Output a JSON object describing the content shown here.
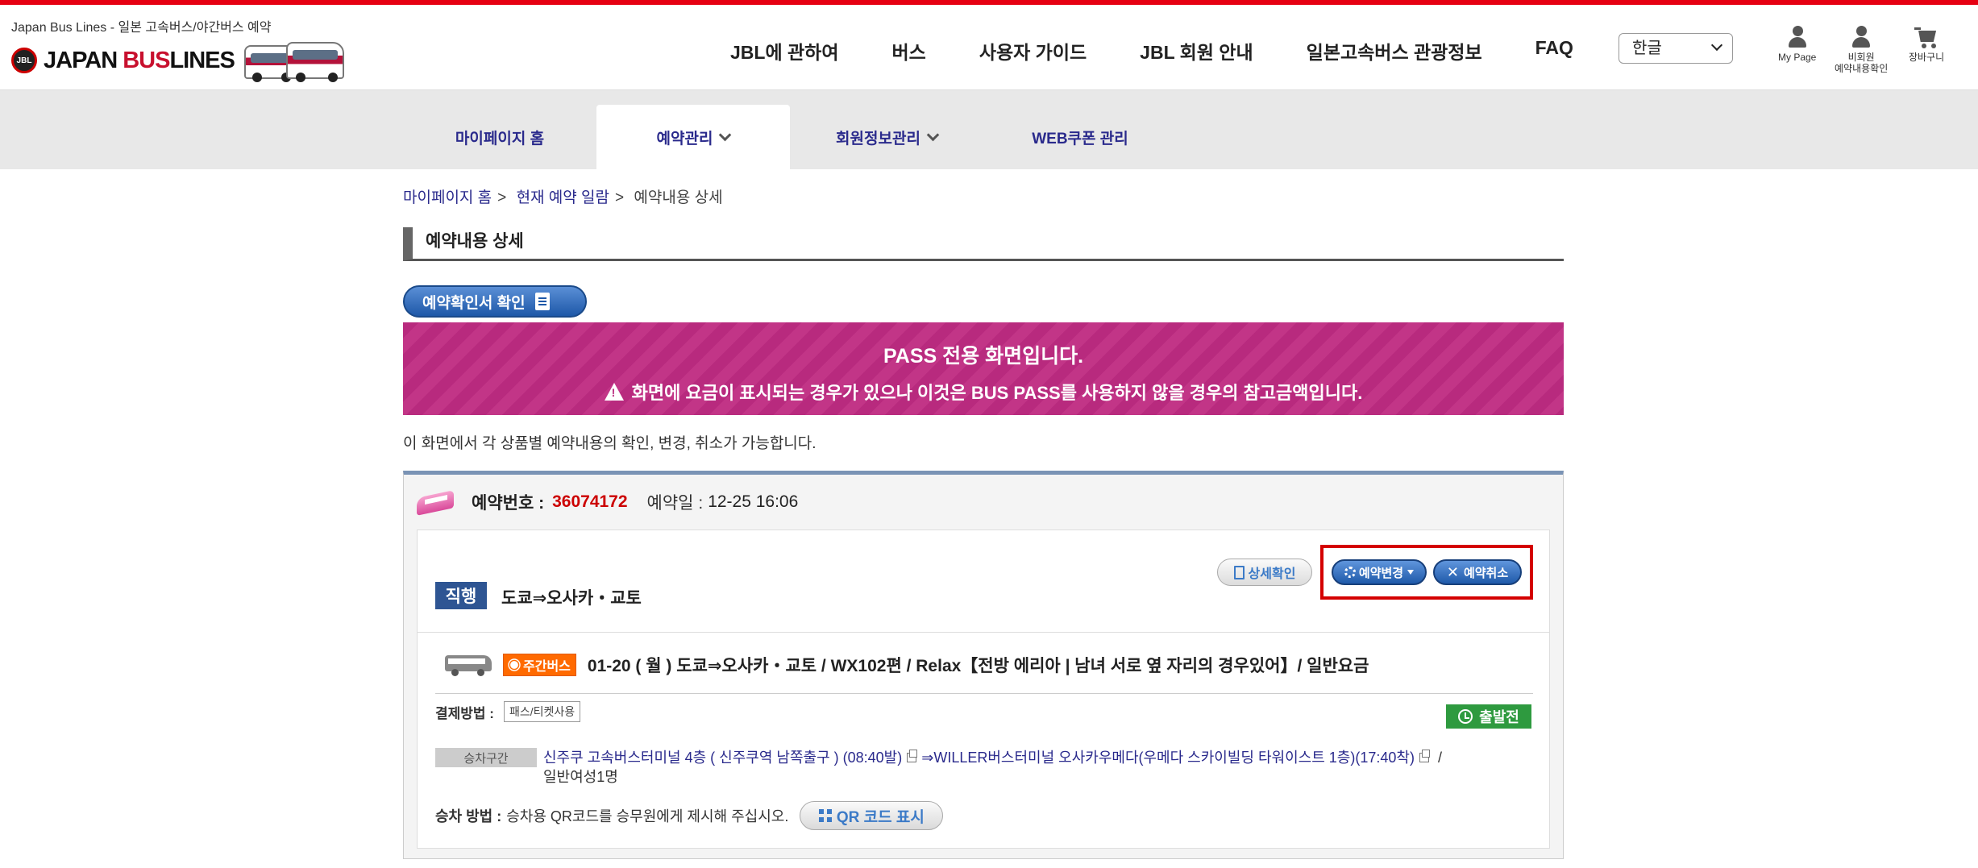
{
  "header": {
    "tagline": "Japan Bus Lines - 일본 고속버스/야간버스 예약",
    "logo_text_a": "JAPAN",
    "logo_text_b": "BUS",
    "logo_text_c": "LINES",
    "logo_badge": "JBL",
    "nav": [
      "JBL에 관하여",
      "버스",
      "사용자 가이드",
      "JBL 회원 안내",
      "일본고속버스 관광정보",
      "FAQ"
    ],
    "language": "한글",
    "mypage_label": "My Page",
    "guest_label_1": "비회원",
    "guest_label_2": "예약내용확인",
    "cart_label": "장바구니"
  },
  "subnav": {
    "items": [
      "마이페이지 홈",
      "예약관리",
      "회원정보관리",
      "WEB쿠폰 관리"
    ],
    "active": "예약관리"
  },
  "breadcrumb": [
    "마이페이지 홈",
    "현재 예약 일람",
    "예약내용 상세"
  ],
  "page_title": "예약내용 상세",
  "confirm_button": "예약확인서 확인",
  "banner": {
    "line1": "PASS 전용 화면입니다.",
    "line2": "화면에 요금이 표시되는 경우가 있으나 이것은 BUS PASS를 사용하지 않을 경우의 참고금액입니다."
  },
  "intro": "이 화면에서 각 상품별 예약내용의 확인, 변경, 취소가 가능합니다.",
  "reservation": {
    "number_label": "예약번호 :",
    "number": "36074172",
    "date_label": "예약일 :",
    "date": "12-25 16:06",
    "buttons": {
      "detail": "상세확인",
      "change": "예약변경",
      "cancel": "예약취소"
    },
    "trip_type": "직행",
    "route": "도쿄⇒오사카・교토",
    "segment": {
      "badge": "주간버스",
      "title": "01-20 ( 월 ) 도쿄⇒오사카・교토 / WX102편 / Relax【전방 에리아 | 남녀 서로 옆 자리의 경우있어】/ 일반요금",
      "payment_label": "결제방법 :",
      "payment_value": "패스/티켓사용",
      "status": "출발전",
      "section_label": "승차구간",
      "depart": "신주쿠 고속버스터미널 4층 ( 신주쿠역 남쪽출구 ) (08:40발)",
      "arrive": "⇒WILLER버스터미널 오사카우메다(우메다 스카이빌딩 타워이스트 1층)(17:40착)",
      "slash": "/",
      "passengers": "일반여성1명",
      "boarding_label": "승차 방법 :",
      "boarding_text": "승차용 QR코드를 승무원에게 제시해 주십시오.",
      "qr_button": "QR 코드 표시"
    }
  }
}
